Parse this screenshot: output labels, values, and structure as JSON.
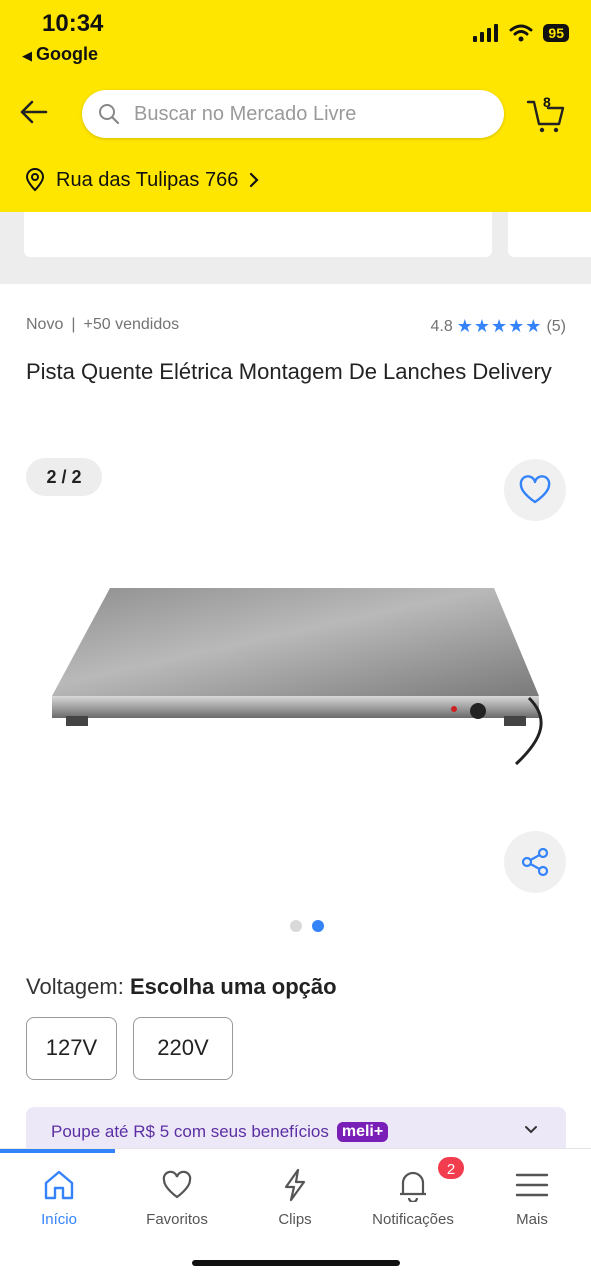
{
  "status": {
    "time": "10:34",
    "back_app": "Google",
    "battery": "95"
  },
  "header": {
    "search_placeholder": "Buscar no Mercado Livre",
    "cart_count": "8",
    "address": "Rua das Tulipas 766"
  },
  "product": {
    "condition": "Novo",
    "sold": "+50 vendidos",
    "rating": "4.8",
    "rating_stars": 5,
    "reviews": "(5)",
    "title": "Pista Quente Elétrica  Montagem De Lanches Delivery",
    "gallery_counter": "2 / 2",
    "gallery_total": 2,
    "gallery_current": 2
  },
  "variation": {
    "label": "Voltagem: ",
    "value": "Escolha uma opção",
    "options": [
      "127V",
      "220V"
    ]
  },
  "promo": {
    "text": "Poupe até R$ 5 com seus benefícios",
    "badge": "meli+"
  },
  "tabs": [
    {
      "label": "Início",
      "icon": "home-icon",
      "active": true
    },
    {
      "label": "Favoritos",
      "icon": "heart-icon",
      "active": false
    },
    {
      "label": "Clips",
      "icon": "clips-icon",
      "active": false
    },
    {
      "label": "Notificações",
      "icon": "bell-icon",
      "active": false,
      "badge": "2"
    },
    {
      "label": "Mais",
      "icon": "menu-icon",
      "active": false
    }
  ],
  "colors": {
    "brand_yellow": "#ffe600",
    "accent_blue": "#3483fa",
    "badge_red": "#f23d4f",
    "meli_purple": "#7a1eb8"
  }
}
